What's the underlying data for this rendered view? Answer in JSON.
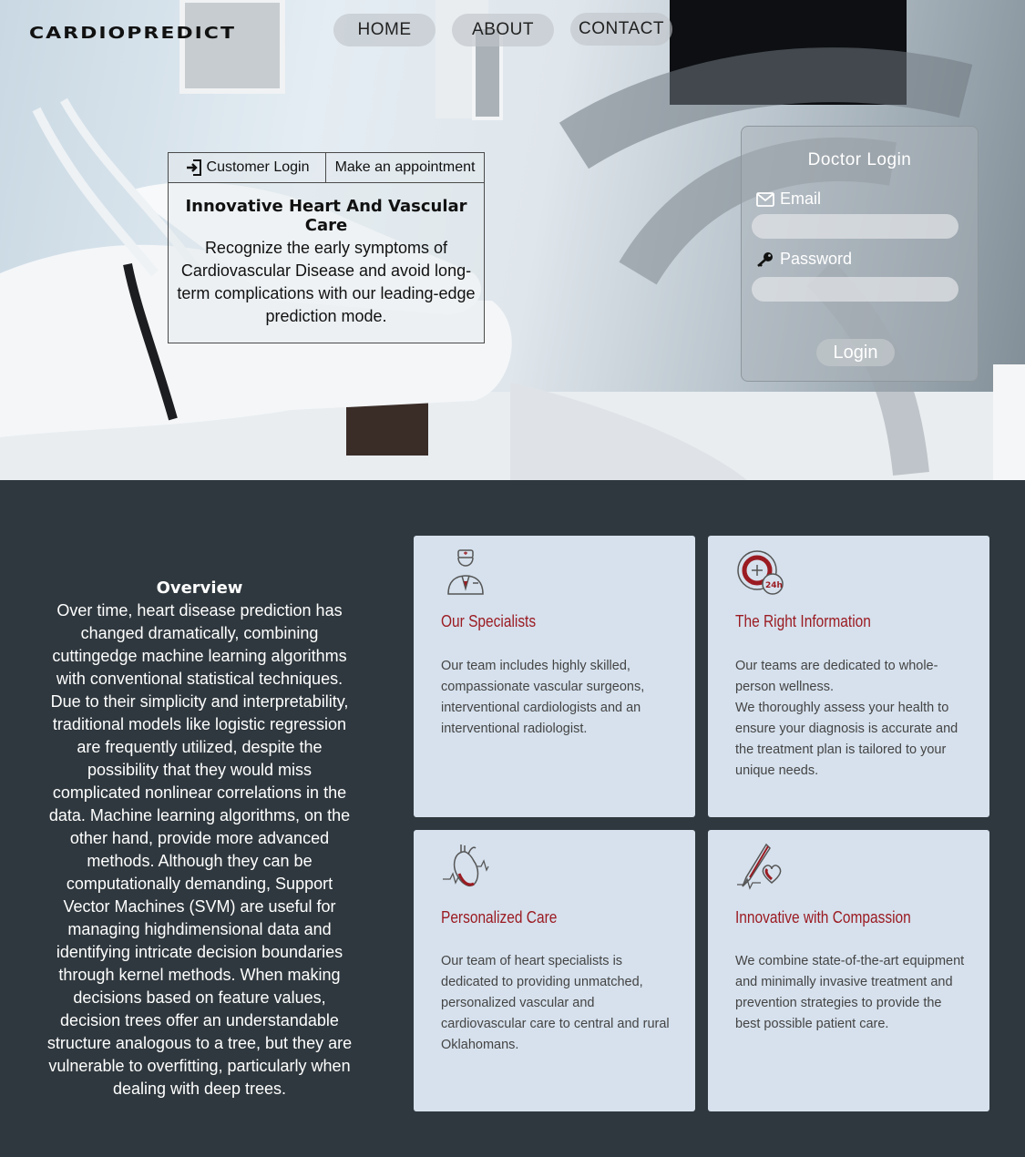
{
  "brand": "CARDIOPREDICT",
  "nav": {
    "home": "HOME",
    "about": "ABOUT",
    "contact": "CONTACT"
  },
  "tabs": {
    "customer_login": "Customer Login",
    "appointment": "Make an appointment"
  },
  "hero": {
    "title": "Innovative Heart And Vascular Care",
    "text": "Recognize the early symptoms of Cardiovascular Disease and avoid long-term complications with our leading-edge prediction mode."
  },
  "doctor_login": {
    "title": "Doctor Login",
    "email_label": "Email",
    "password_label": "Password",
    "email_value": "",
    "password_value": "",
    "button": "Login"
  },
  "overview": {
    "title": "Overview",
    "text": "Over time, heart disease prediction has changed dramatically, combining cuttingedge machine learning algorithms with conventional statistical techniques. Due to their simplicity and interpretability, traditional models like logistic regression are frequently utilized, despite the possibility that they would miss complicated nonlinear correlations in the data. Machine learning algorithms, on the other hand, provide more advanced methods. Although they can be computationally demanding, Support Vector Machines (SVM) are useful for managing highdimensional data and identifying intricate decision boundaries through kernel methods. When making decisions based on feature values, decision trees offer an understandable structure analogous to a tree, but they are vulnerable to overfitting, particularly when dealing with deep trees."
  },
  "cards": [
    {
      "icon": "doctor-icon",
      "title": "Our Specialists",
      "text": "Our team includes highly skilled, compassionate vascular surgeons, interventional cardiologists and an interventional radiologist."
    },
    {
      "icon": "24h-icon",
      "title": "The Right Information",
      "text": "Our teams are dedicated to whole-person wellness.\nWe thoroughly assess your health to ensure your diagnosis is accurate and the treatment plan is tailored to your unique needs."
    },
    {
      "icon": "anatomical-heart-icon",
      "title": "Personalized Care",
      "text": "Our team of heart specialists is dedicated to providing unmatched, personalized vascular and cardiovascular care to central and rural Oklahomans."
    },
    {
      "icon": "scalpel-heart-icon",
      "title": "Innovative with Compassion",
      "text": "We combine state-of-the-art equipment and minimally invasive treatment and prevention strategies to provide the best possible patient care."
    }
  ],
  "colors": {
    "accent": "#9b1b22",
    "section_bg": "#2f383e",
    "card_bg": "#d6e1ed"
  }
}
